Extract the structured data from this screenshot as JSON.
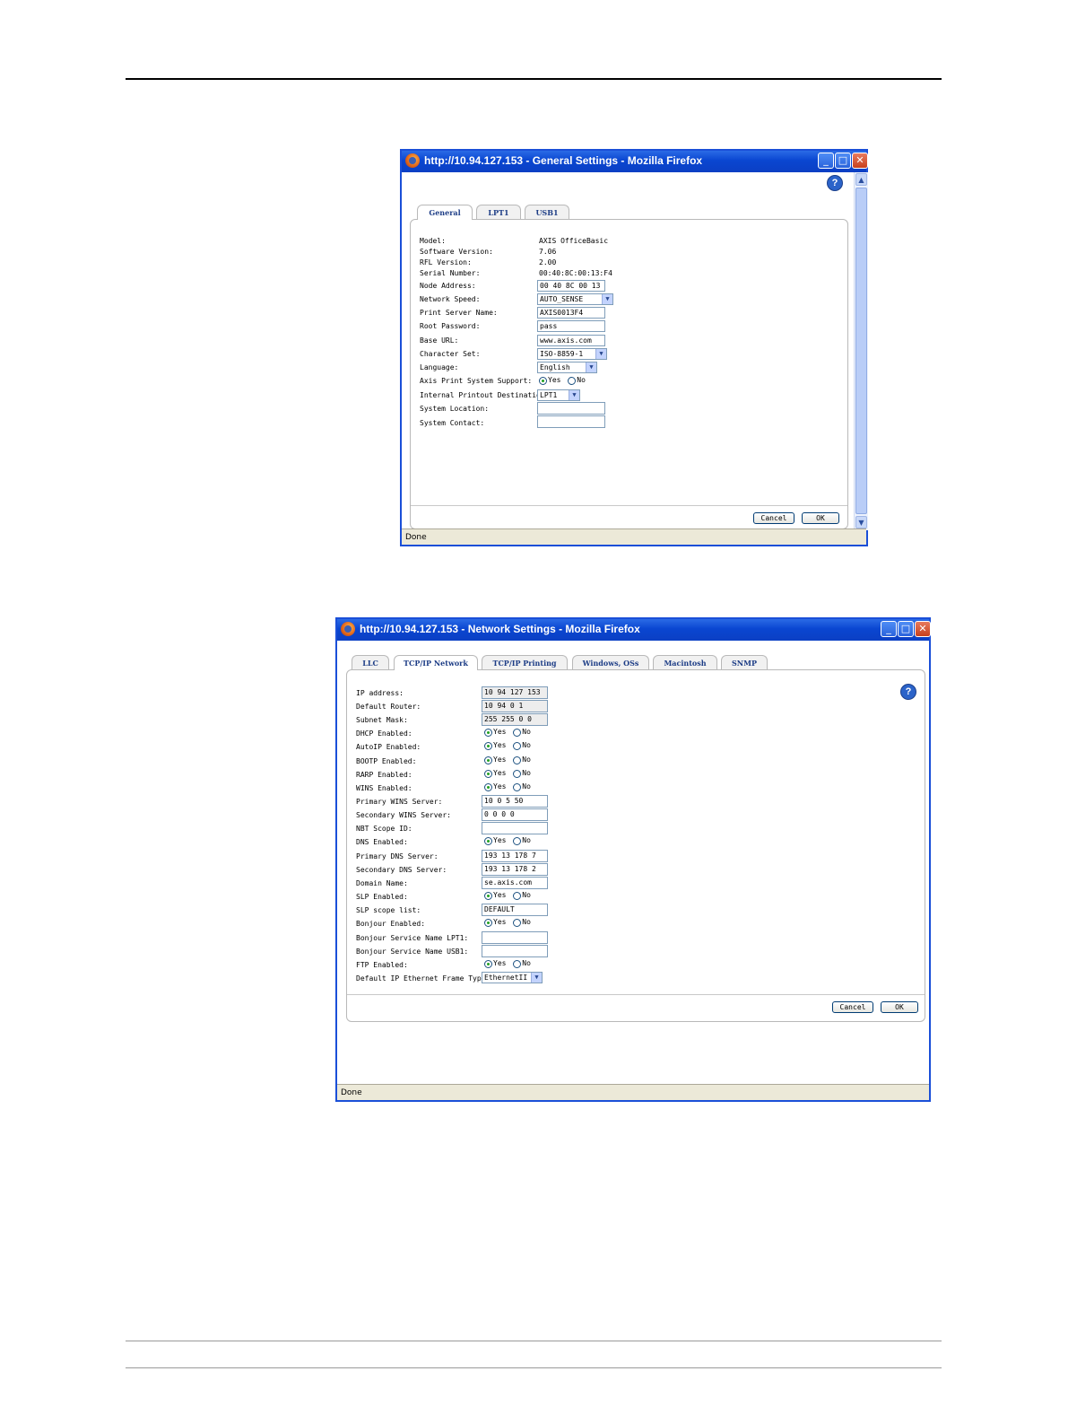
{
  "win1": {
    "title": "http://10.94.127.153 - General Settings - Mozilla Firefox",
    "tabs": [
      "General",
      "LPT1",
      "USB1"
    ],
    "fields": {
      "model_label": "Model:",
      "model_value": "AXIS OfficeBasic",
      "software_label": "Software Version:",
      "software_value": "7.06",
      "rfl_label": "RFL Version:",
      "rfl_value": "2.00",
      "serial_label": "Serial Number:",
      "serial_value": "00:40:8C:00:13:F4",
      "node_label": "Node Address:",
      "node_value": "00 40 8C 00 13",
      "speed_label": "Network Speed:",
      "speed_value": "AUTO_SENSE",
      "psname_label": "Print Server Name:",
      "psname_value": "AXIS0013F4",
      "rootpw_label": "Root Password:",
      "rootpw_value": "pass",
      "baseurl_label": "Base URL:",
      "baseurl_value": "www.axis.com",
      "charset_label": "Character Set:",
      "charset_value": "ISO-8859-1",
      "lang_label": "Language:",
      "lang_value": "English",
      "apss_label": "Axis Print System Support:",
      "ipd_label": "Internal Printout Destination:",
      "ipd_value": "LPT1",
      "sysloc_label": "System Location:",
      "sysloc_value": "",
      "syscon_label": "System Contact:",
      "syscon_value": ""
    },
    "yes": "Yes",
    "no": "No",
    "cancel": "Cancel",
    "ok": "OK",
    "status": "Done"
  },
  "win2": {
    "title": "http://10.94.127.153 - Network Settings - Mozilla Firefox",
    "tabs": [
      "LLC",
      "TCP/IP Network",
      "TCP/IP Printing",
      "Windows, OSs",
      "Macintosh",
      "SNMP"
    ],
    "fields": {
      "ip_label": "IP address:",
      "ip_value": "10 94 127 153",
      "router_label": "Default Router:",
      "router_value": "10 94 0 1",
      "mask_label": "Subnet Mask:",
      "mask_value": "255 255 0 0",
      "dhcp_label": "DHCP Enabled:",
      "autoip_label": "AutoIP Enabled:",
      "bootp_label": "BOOTP Enabled:",
      "rarp_label": "RARP Enabled:",
      "wins_label": "WINS Enabled:",
      "pwins_label": "Primary WINS Server:",
      "pwins_value": "10 0 5 50",
      "swins_label": "Secondary WINS Server:",
      "swins_value": "0 0 0 0",
      "nbt_label": "NBT Scope ID:",
      "nbt_value": "",
      "dns_label": "DNS Enabled:",
      "pdns_label": "Primary DNS Server:",
      "pdns_value": "193 13 178 7",
      "sdns_label": "Secondary DNS Server:",
      "sdns_value": "193 13 178 2",
      "domain_label": "Domain Name:",
      "domain_value": "se.axis.com",
      "slp_label": "SLP Enabled:",
      "slpscope_label": "SLP scope list:",
      "slpscope_value": "DEFAULT",
      "bonjour_label": "Bonjour Enabled:",
      "bsn_lpt_label": "Bonjour Service Name LPT1:",
      "bsn_lpt_value": "",
      "bsn_usb_label": "Bonjour Service Name USB1:",
      "bsn_usb_value": "",
      "ftp_label": "FTP Enabled:",
      "frame_label": "Default IP Ethernet Frame Type:",
      "frame_value": "EthernetII"
    },
    "yes": "Yes",
    "no": "No",
    "cancel": "Cancel",
    "ok": "OK",
    "status": "Done"
  }
}
